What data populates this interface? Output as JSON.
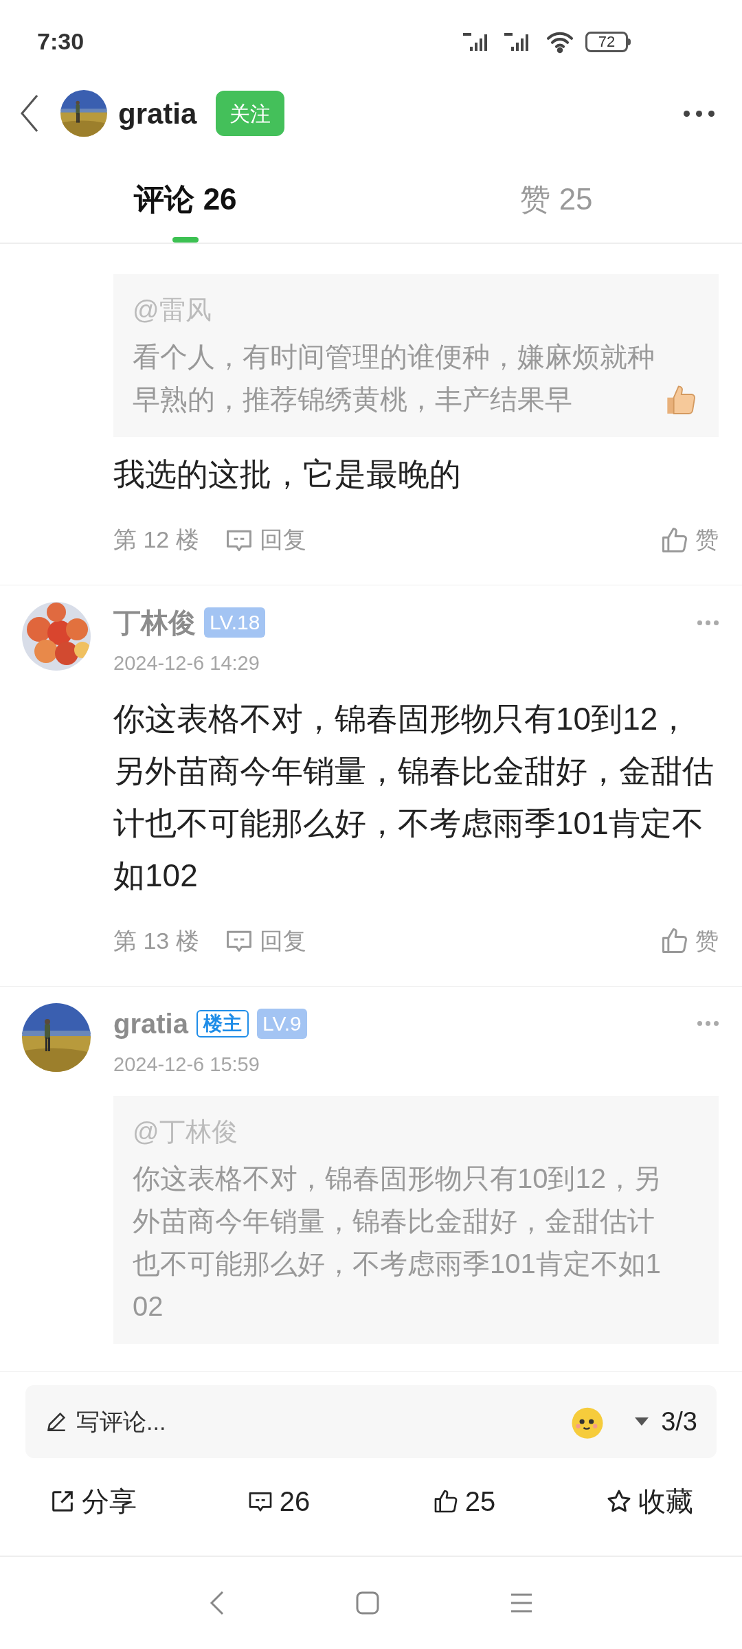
{
  "status_bar": {
    "time": "7:30",
    "battery": "72"
  },
  "header": {
    "username": "gratia",
    "follow_button": "关注"
  },
  "tabs": [
    {
      "label": "评论 26",
      "selected": true
    },
    {
      "label": "赞 25",
      "selected": false
    }
  ],
  "comments": [
    {
      "quote": {
        "mention": "@雷风",
        "text": "看个人，有时间管理的谁便种，嫌麻烦就种早熟的，推荐锦绣黄桃，丰产结果早"
      },
      "text": "我选的这批，它是最晚的",
      "floor": "第 12 楼",
      "reply": "回复",
      "like": "赞"
    },
    {
      "author": "丁林俊",
      "level": "LV.18",
      "date": "2024-12-6 14:29",
      "text": "你这表格不对，锦春固形物只有10到12，另外苗商今年销量，锦春比金甜好，金甜估计也不可能那么好，不考虑雨季101肯定不如102",
      "floor": "第 13 楼",
      "reply": "回复",
      "like": "赞"
    },
    {
      "author": "gratia",
      "owner_badge": "楼主",
      "level": "LV.9",
      "date": "2024-12-6 15:59",
      "quote": {
        "mention": "@丁林俊",
        "text": "你这表格不对，锦春固形物只有10到12，另外苗商今年销量，锦春比金甜好，金甜估计也不可能那么好，不考虑雨季101肯定不如102"
      }
    }
  ],
  "comment_bar": {
    "placeholder": "写评论...",
    "page": "3/3"
  },
  "actions": [
    {
      "kind": "share",
      "label": "分享"
    },
    {
      "kind": "comment",
      "label": "26"
    },
    {
      "kind": "like",
      "label": "25"
    },
    {
      "kind": "favorite",
      "label": "收藏"
    }
  ]
}
